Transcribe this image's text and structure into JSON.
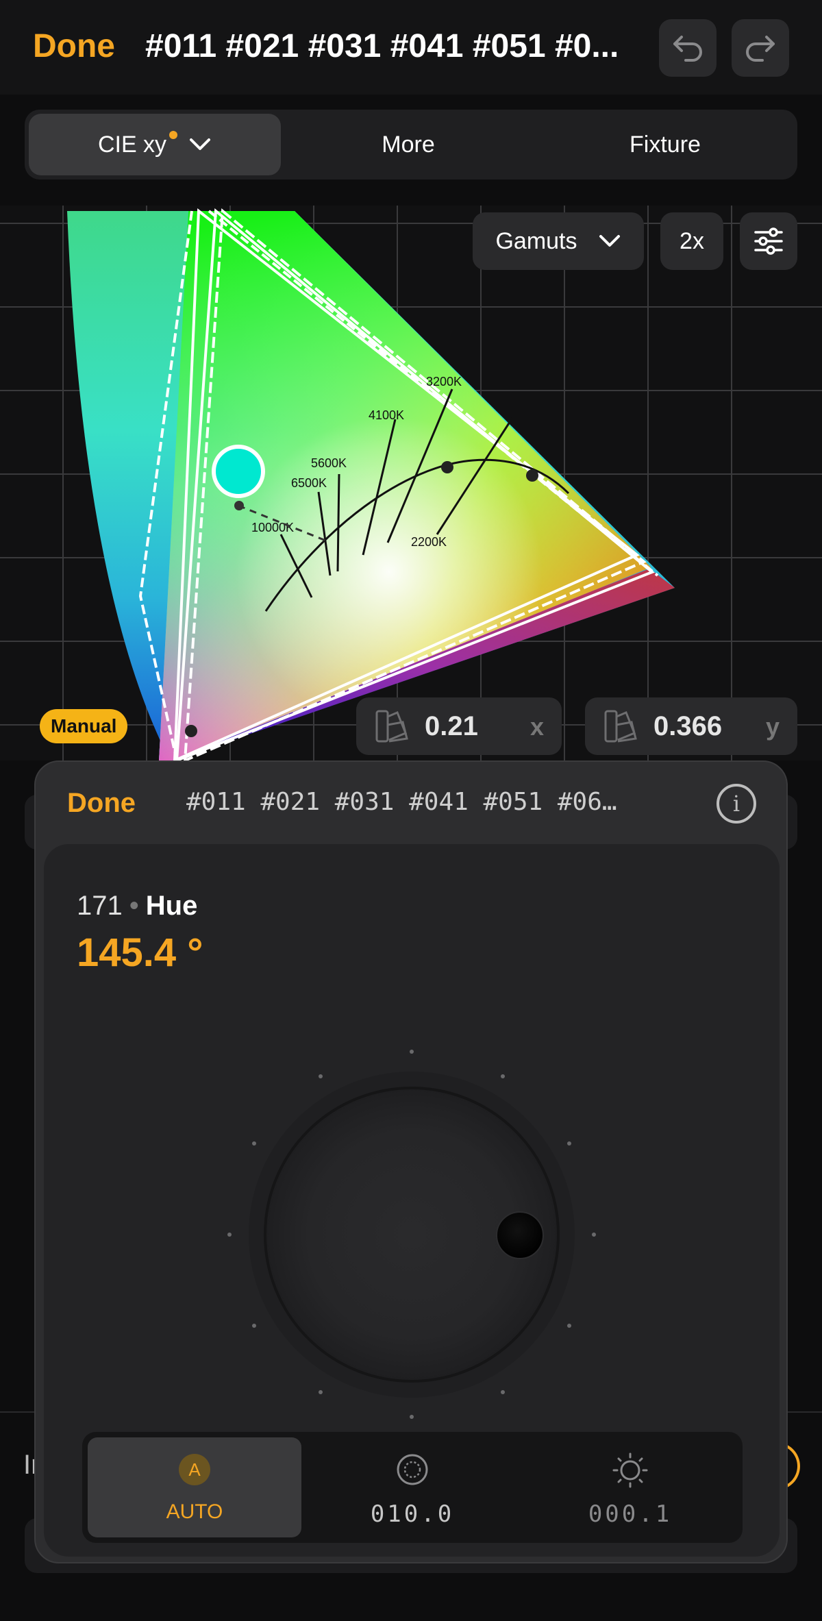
{
  "header": {
    "done_label": "Done",
    "title": "#011 #021 #031 #041 #051 #0...",
    "undo_icon": "undo-icon",
    "redo_icon": "redo-icon"
  },
  "tabs": [
    {
      "label": "CIE xy",
      "active": true,
      "has_dot": true
    },
    {
      "label": "More",
      "active": false
    },
    {
      "label": "Fixture",
      "active": false
    }
  ],
  "chart_controls": {
    "gamuts_label": "Gamuts",
    "zoom_label": "2x",
    "settings_icon": "sliders-icon"
  },
  "chart_data": {
    "type": "scatter",
    "title": "",
    "xlabel": "x",
    "ylabel": "y",
    "grid": true,
    "cct_labels": [
      "3200K",
      "4100K",
      "5600K",
      "6500K",
      "10000K",
      "2200K"
    ],
    "selected_point": {
      "x": 0.21,
      "y": 0.366
    }
  },
  "mode_badge": "Manual",
  "coords": {
    "x_value": "0.21",
    "x_axis": "x",
    "y_value": "0.366",
    "y_axis": "y"
  },
  "sheet": {
    "done_label": "Done",
    "title": "#011 #021 #031 #041 #051 #06…",
    "info_icon": "info-icon",
    "info_glyph": "i",
    "param_number": "171",
    "param_separator": "•",
    "param_name": "Hue",
    "param_value": "145.4 °"
  },
  "modes": {
    "auto_letter": "A",
    "auto_label": "AUTO",
    "fine_value": "010.0",
    "ultra_value": "000.1"
  },
  "background": {
    "hidden_letter": "Ir"
  },
  "colors": {
    "accent": "#f5a623",
    "badge": "#f5b316",
    "background": "#0d0d0e"
  }
}
